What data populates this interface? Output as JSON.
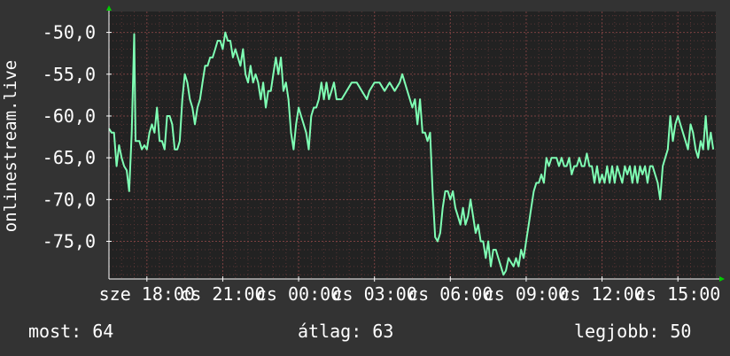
{
  "chart_data": {
    "type": "line",
    "title": "",
    "ylabel": "onlinestream.live",
    "xlabel": "",
    "ylim": [
      -79.5,
      -47.5
    ],
    "yticks": [
      -50,
      -55,
      -60,
      -65,
      -70,
      -75
    ],
    "ytick_labels": [
      "-50,0",
      "-55,0",
      "-60,0",
      "-65,0",
      "-70,0",
      "-75,0"
    ],
    "xlim": [
      0,
      24
    ],
    "xticks": [
      {
        "x": 1.5,
        "label": "sze 18:00"
      },
      {
        "x": 4.5,
        "label": "cs 21:00"
      },
      {
        "x": 7.5,
        "label": "cs 00:00"
      },
      {
        "x": 10.5,
        "label": "cs 03:00"
      },
      {
        "x": 13.5,
        "label": "cs 06:00"
      },
      {
        "x": 16.5,
        "label": "cs 09:00"
      },
      {
        "x": 19.5,
        "label": "cs 12:00"
      },
      {
        "x": 22.5,
        "label": "cs 15:00"
      }
    ],
    "grid": true,
    "series": [
      {
        "name": "",
        "color": "#7fffb4",
        "values": [
          [
            0.0,
            -61.5
          ],
          [
            0.1,
            -62
          ],
          [
            0.2,
            -62
          ],
          [
            0.3,
            -66
          ],
          [
            0.4,
            -63.5
          ],
          [
            0.5,
            -65
          ],
          [
            0.6,
            -66
          ],
          [
            0.7,
            -66.5
          ],
          [
            0.8,
            -69
          ],
          [
            0.9,
            -62
          ],
          [
            1.0,
            -50.2
          ],
          [
            1.05,
            -63
          ],
          [
            1.2,
            -63
          ],
          [
            1.3,
            -64
          ],
          [
            1.4,
            -63.5
          ],
          [
            1.5,
            -64
          ],
          [
            1.6,
            -62
          ],
          [
            1.7,
            -61
          ],
          [
            1.8,
            -62
          ],
          [
            1.9,
            -59
          ],
          [
            2.0,
            -63
          ],
          [
            2.1,
            -63
          ],
          [
            2.2,
            -64
          ],
          [
            2.3,
            -60
          ],
          [
            2.4,
            -60
          ],
          [
            2.5,
            -61
          ],
          [
            2.6,
            -64
          ],
          [
            2.7,
            -64
          ],
          [
            2.8,
            -63
          ],
          [
            2.9,
            -58
          ],
          [
            3.0,
            -55
          ],
          [
            3.1,
            -56
          ],
          [
            3.2,
            -58
          ],
          [
            3.3,
            -59
          ],
          [
            3.4,
            -61
          ],
          [
            3.5,
            -59
          ],
          [
            3.6,
            -58
          ],
          [
            3.7,
            -56
          ],
          [
            3.8,
            -54
          ],
          [
            3.9,
            -54
          ],
          [
            4.0,
            -53
          ],
          [
            4.1,
            -53
          ],
          [
            4.2,
            -52
          ],
          [
            4.3,
            -51
          ],
          [
            4.4,
            -51
          ],
          [
            4.5,
            -52
          ],
          [
            4.6,
            -50
          ],
          [
            4.7,
            -51
          ],
          [
            4.8,
            -51
          ],
          [
            4.9,
            -53
          ],
          [
            5.0,
            -52
          ],
          [
            5.1,
            -53
          ],
          [
            5.2,
            -54
          ],
          [
            5.3,
            -52
          ],
          [
            5.4,
            -55
          ],
          [
            5.5,
            -56
          ],
          [
            5.6,
            -54
          ],
          [
            5.7,
            -56
          ],
          [
            5.8,
            -55
          ],
          [
            5.9,
            -56
          ],
          [
            6.0,
            -58
          ],
          [
            6.1,
            -56
          ],
          [
            6.2,
            -59
          ],
          [
            6.3,
            -57
          ],
          [
            6.4,
            -57
          ],
          [
            6.5,
            -55
          ],
          [
            6.6,
            -53
          ],
          [
            6.7,
            -55
          ],
          [
            6.8,
            -53
          ],
          [
            6.9,
            -57
          ],
          [
            7.0,
            -56
          ],
          [
            7.1,
            -58
          ],
          [
            7.2,
            -62
          ],
          [
            7.3,
            -64
          ],
          [
            7.4,
            -61
          ],
          [
            7.5,
            -59
          ],
          [
            7.6,
            -60
          ],
          [
            7.7,
            -61
          ],
          [
            7.8,
            -62
          ],
          [
            7.9,
            -64
          ],
          [
            8.0,
            -60
          ],
          [
            8.1,
            -59
          ],
          [
            8.2,
            -59
          ],
          [
            8.3,
            -58
          ],
          [
            8.4,
            -56
          ],
          [
            8.5,
            -58
          ],
          [
            8.6,
            -56
          ],
          [
            8.7,
            -58
          ],
          [
            8.8,
            -57
          ],
          [
            8.9,
            -56
          ],
          [
            9.0,
            -58
          ],
          [
            9.2,
            -58
          ],
          [
            9.4,
            -57
          ],
          [
            9.6,
            -56
          ],
          [
            9.8,
            -56
          ],
          [
            10.0,
            -57
          ],
          [
            10.2,
            -58
          ],
          [
            10.3,
            -57
          ],
          [
            10.5,
            -56
          ],
          [
            10.7,
            -56
          ],
          [
            10.9,
            -57
          ],
          [
            11.1,
            -56
          ],
          [
            11.3,
            -57
          ],
          [
            11.5,
            -56
          ],
          [
            11.6,
            -55
          ],
          [
            11.8,
            -57
          ],
          [
            12.0,
            -59
          ],
          [
            12.1,
            -58
          ],
          [
            12.2,
            -61
          ],
          [
            12.3,
            -58
          ],
          [
            12.4,
            -62
          ],
          [
            12.5,
            -62
          ],
          [
            12.6,
            -63
          ],
          [
            12.7,
            -62
          ],
          [
            12.8,
            -69
          ],
          [
            12.9,
            -74.5
          ],
          [
            13.0,
            -75
          ],
          [
            13.1,
            -74
          ],
          [
            13.2,
            -71
          ],
          [
            13.3,
            -69
          ],
          [
            13.4,
            -69
          ],
          [
            13.5,
            -70
          ],
          [
            13.6,
            -69
          ],
          [
            13.7,
            -71
          ],
          [
            13.8,
            -72
          ],
          [
            13.9,
            -73
          ],
          [
            14.0,
            -71
          ],
          [
            14.1,
            -73
          ],
          [
            14.2,
            -72
          ],
          [
            14.3,
            -70
          ],
          [
            14.4,
            -72
          ],
          [
            14.5,
            -74
          ],
          [
            14.6,
            -73
          ],
          [
            14.7,
            -75
          ],
          [
            14.8,
            -75
          ],
          [
            14.9,
            -77
          ],
          [
            15.0,
            -75
          ],
          [
            15.1,
            -78
          ],
          [
            15.2,
            -76
          ],
          [
            15.3,
            -76
          ],
          [
            15.4,
            -77
          ],
          [
            15.5,
            -78
          ],
          [
            15.6,
            -79
          ],
          [
            15.7,
            -78.5
          ],
          [
            15.8,
            -77
          ],
          [
            15.9,
            -77.5
          ],
          [
            16.0,
            -78
          ],
          [
            16.1,
            -77
          ],
          [
            16.2,
            -78
          ],
          [
            16.3,
            -76
          ],
          [
            16.4,
            -77
          ],
          [
            16.5,
            -75
          ],
          [
            16.6,
            -73
          ],
          [
            16.7,
            -71
          ],
          [
            16.8,
            -69
          ],
          [
            16.9,
            -68
          ],
          [
            17.0,
            -68
          ],
          [
            17.1,
            -67
          ],
          [
            17.2,
            -68
          ],
          [
            17.3,
            -65
          ],
          [
            17.4,
            -66
          ],
          [
            17.5,
            -65
          ],
          [
            17.6,
            -65
          ],
          [
            17.7,
            -65
          ],
          [
            17.8,
            -66
          ],
          [
            17.9,
            -65
          ],
          [
            18.0,
            -66
          ],
          [
            18.1,
            -66
          ],
          [
            18.2,
            -65
          ],
          [
            18.3,
            -67
          ],
          [
            18.4,
            -66
          ],
          [
            18.5,
            -66
          ],
          [
            18.6,
            -65
          ],
          [
            18.7,
            -66
          ],
          [
            18.8,
            -66
          ],
          [
            18.9,
            -64.5
          ],
          [
            19.0,
            -66
          ],
          [
            19.1,
            -66
          ],
          [
            19.2,
            -68
          ],
          [
            19.3,
            -66
          ],
          [
            19.4,
            -68
          ],
          [
            19.5,
            -67
          ],
          [
            19.6,
            -68
          ],
          [
            19.7,
            -66
          ],
          [
            19.8,
            -68
          ],
          [
            19.9,
            -66
          ],
          [
            20.0,
            -68
          ],
          [
            20.1,
            -66
          ],
          [
            20.2,
            -67
          ],
          [
            20.3,
            -68
          ],
          [
            20.4,
            -66
          ],
          [
            20.5,
            -67
          ],
          [
            20.6,
            -66
          ],
          [
            20.7,
            -68
          ],
          [
            20.8,
            -66
          ],
          [
            20.9,
            -68
          ],
          [
            21.0,
            -66
          ],
          [
            21.1,
            -67
          ],
          [
            21.2,
            -66
          ],
          [
            21.3,
            -68
          ],
          [
            21.4,
            -66
          ],
          [
            21.5,
            -66
          ],
          [
            21.6,
            -67
          ],
          [
            21.7,
            -68
          ],
          [
            21.8,
            -70
          ],
          [
            21.9,
            -66
          ],
          [
            22.0,
            -65
          ],
          [
            22.1,
            -64
          ],
          [
            22.2,
            -60
          ],
          [
            22.3,
            -63
          ],
          [
            22.4,
            -61
          ],
          [
            22.5,
            -60
          ],
          [
            22.6,
            -61
          ],
          [
            22.7,
            -62
          ],
          [
            22.8,
            -63
          ],
          [
            22.9,
            -64
          ],
          [
            23.0,
            -61
          ],
          [
            23.1,
            -62
          ],
          [
            23.2,
            -64
          ],
          [
            23.3,
            -65
          ],
          [
            23.4,
            -63
          ],
          [
            23.5,
            -64
          ],
          [
            23.6,
            -60
          ],
          [
            23.7,
            -64
          ],
          [
            23.8,
            -62
          ],
          [
            23.9,
            -64
          ]
        ]
      }
    ]
  },
  "footer": {
    "current": "most: 64",
    "average": "átlag: 63",
    "best": "legjobb: 50"
  },
  "colors": {
    "background": "#333333",
    "plot_background": "#222222",
    "line": "#7fffb4",
    "grid_minor": "#5a3535",
    "grid_major": "#7a4040",
    "axis": "#ffffff",
    "arrow": "#00cc00"
  }
}
